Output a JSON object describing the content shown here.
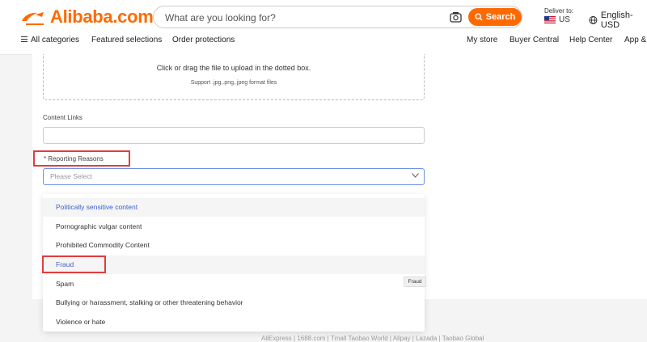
{
  "header": {
    "logo_text": "Alibaba.com",
    "search": {
      "placeholder": "What are you looking for?",
      "button_label": "Search"
    },
    "deliver_to": {
      "label": "Deliver to:",
      "country": "US"
    },
    "language": "English-USD"
  },
  "nav": {
    "left": [
      "All categories",
      "Featured selections",
      "Order protections"
    ],
    "right": [
      "My store",
      "Buyer Central",
      "Help Center",
      "App & e"
    ]
  },
  "form": {
    "upload_main": "Click or drag the file to upload in the dotted box.",
    "upload_sub": "Support .jpg,.png,.jpeg format files",
    "content_links_label": "Content Links",
    "reporting_reasons_label": "* Reporting Reasons",
    "reasons_placeholder": "Please Select"
  },
  "dropdown": {
    "options": [
      "Politically sensitive content",
      "Pornographic vulgar content",
      "Prohibited Commodity Content",
      "Fraud",
      "Spam",
      "Bullying or harassment, stalking or other threatening behavior",
      "Violence or hate"
    ]
  },
  "tooltip": "Fraud",
  "footer": "AliExpress | 1688.com | Tmall Taobao World | Alipay | Lazada | Taobao Global",
  "colors": {
    "brand": "#ff6a00",
    "highlight_text": "#3b5fcc",
    "annotation": "#e23c3c"
  }
}
